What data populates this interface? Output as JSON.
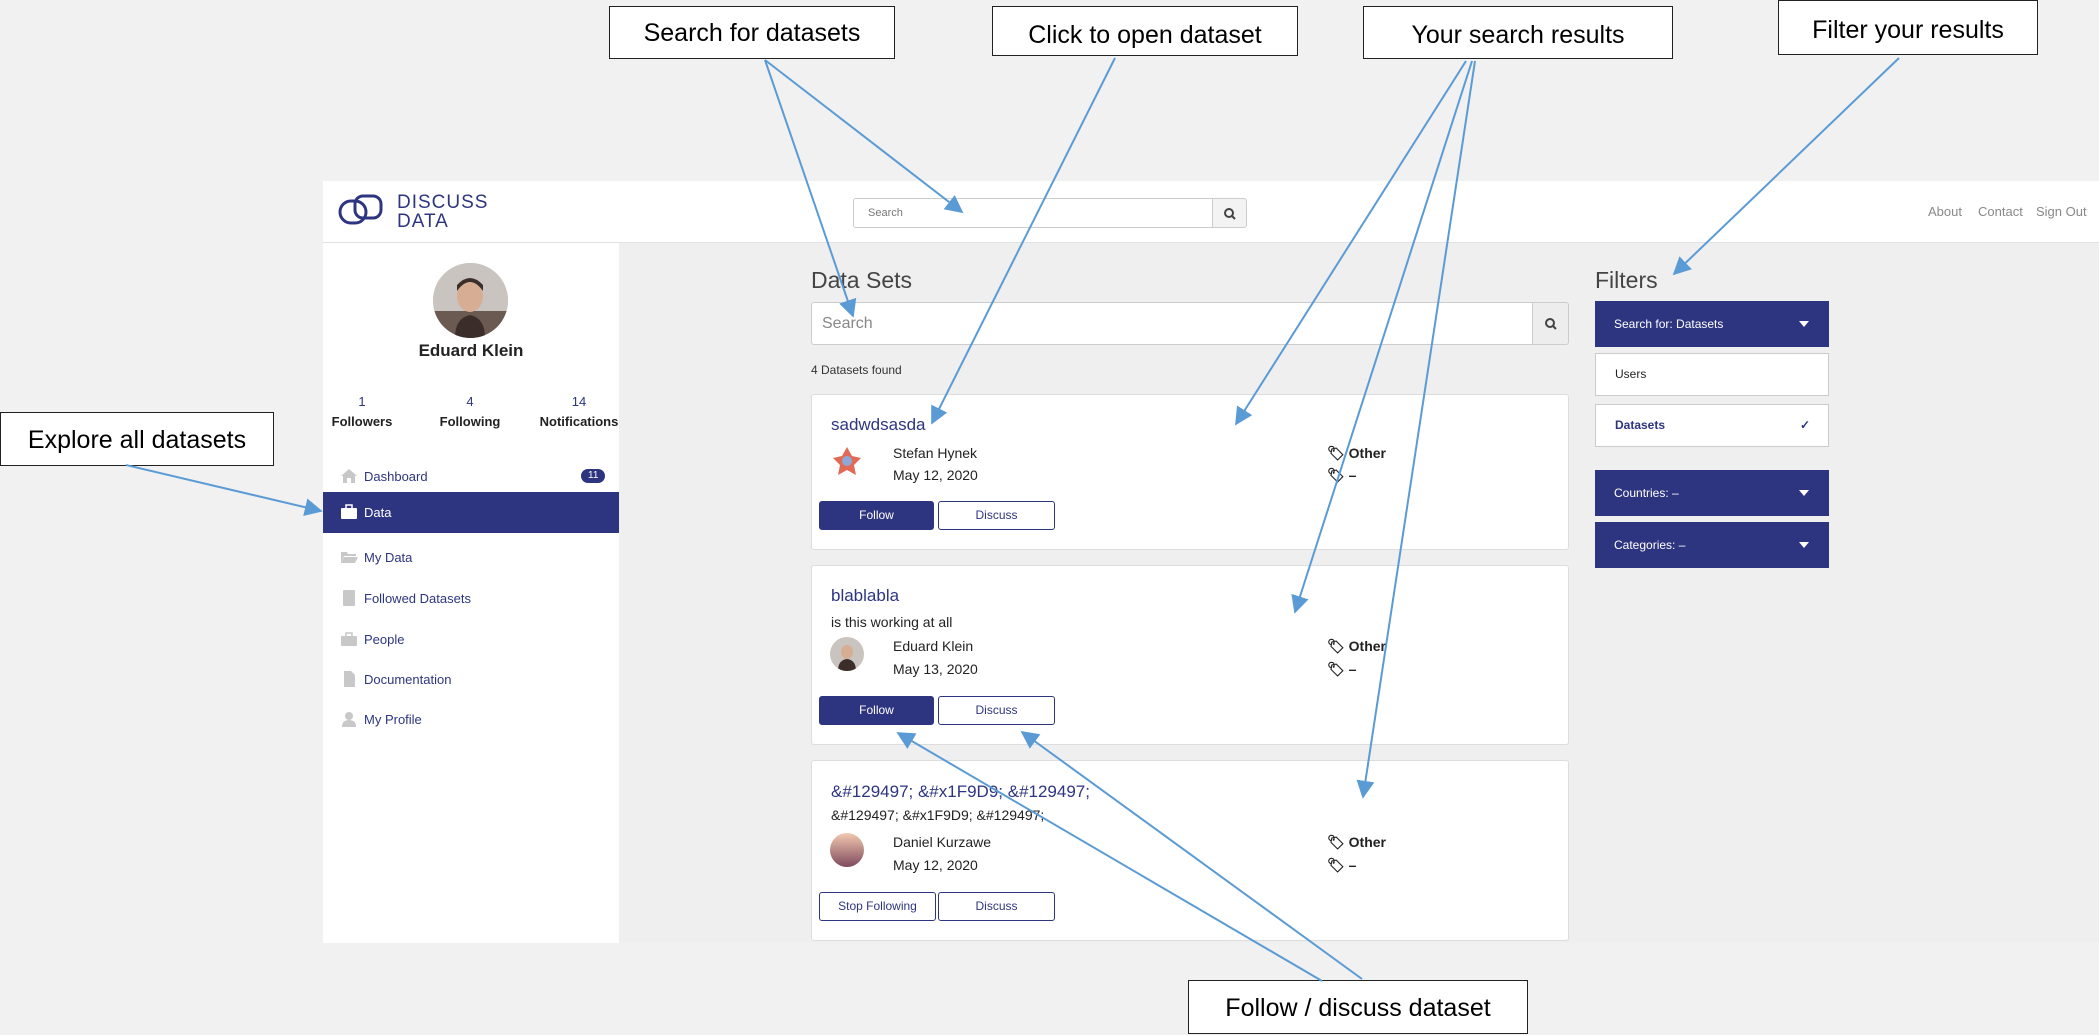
{
  "annotations": {
    "search_datasets": "Search for datasets",
    "click_open": "Click to open dataset",
    "search_results": "Your search results",
    "filter_results": "Filter your results",
    "explore_all": "Explore all datasets",
    "follow_discuss": "Follow / discuss dataset"
  },
  "header": {
    "logo_line1": "DISCUSS",
    "logo_line2": "DATA",
    "search_placeholder": "Search",
    "links": [
      "About",
      "Contact",
      "Sign Out"
    ]
  },
  "sidebar": {
    "user_name": "Eduard Klein",
    "stats": [
      {
        "value": "1",
        "label": "Followers"
      },
      {
        "value": "4",
        "label": "Following"
      },
      {
        "value": "14",
        "label": "Notifications"
      }
    ],
    "items": [
      {
        "label": "Dashboard",
        "icon": "home-icon",
        "badge": "11"
      },
      {
        "label": "Data",
        "icon": "briefcase-icon",
        "active": true
      },
      {
        "label": "My Data",
        "icon": "folder-open-icon"
      },
      {
        "label": "Followed Datasets",
        "icon": "book-icon"
      },
      {
        "label": "People",
        "icon": "briefcase-icon"
      },
      {
        "label": "Documentation",
        "icon": "file-icon"
      },
      {
        "label": "My Profile",
        "icon": "user-icon"
      }
    ]
  },
  "main": {
    "title": "Data Sets",
    "search_placeholder": "Search",
    "found_text": "4 Datasets found",
    "datasets": [
      {
        "title": "sadwdsasda",
        "description": "",
        "author": "Stefan Hynek",
        "date": "May 12, 2020",
        "category": "Other",
        "tags": "–",
        "follow_label": "Follow",
        "discuss_label": "Discuss"
      },
      {
        "title": "blablabla",
        "description": "is this working at all",
        "author": "Eduard Klein",
        "date": "May 13, 2020",
        "category": "Other",
        "tags": "–",
        "follow_label": "Follow",
        "discuss_label": "Discuss"
      },
      {
        "title": "&#129497; &#x1F9D9; &#129497;",
        "description": "&#129497; &#x1F9D9; &#129497;",
        "author": "Daniel Kurzawe",
        "date": "May 12, 2020",
        "category": "Other",
        "tags": "–",
        "follow_label": "Stop Following",
        "discuss_label": "Discuss"
      }
    ]
  },
  "filters": {
    "title": "Filters",
    "search_for": "Search for: Datasets",
    "options": [
      {
        "label": "Users",
        "checked": false
      },
      {
        "label": "Datasets",
        "checked": true,
        "check_mark": "✓"
      }
    ],
    "countries": "Countries: –",
    "categories": "Categories: –"
  },
  "colors": {
    "brand": "#2e3580",
    "annotation_arrow": "#5b9bd5"
  }
}
